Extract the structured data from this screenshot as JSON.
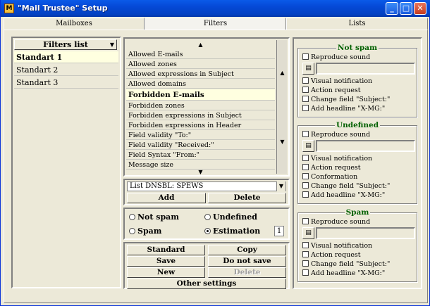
{
  "window": {
    "title": "\"Mail Trustee\" Setup",
    "app_icon": "M"
  },
  "titlebar_buttons": {
    "minimize": "_",
    "maximize": "□",
    "close": "✕"
  },
  "tabs": [
    {
      "label": "Mailboxes",
      "active": false
    },
    {
      "label": "Filters",
      "active": true
    },
    {
      "label": "Lists",
      "active": false
    }
  ],
  "filters_list": {
    "header": "Filters list",
    "dropdown_icon": "▼",
    "items": [
      "Standart 1",
      "Standart 2",
      "Standart 3"
    ],
    "selected": "Standart 1"
  },
  "rules": {
    "scroll_up": "▲",
    "scroll_down": "▼",
    "items": [
      "Allowed E-mails",
      "Allowed zones",
      "Allowed expressions in Subject",
      "Allowed domains",
      "Forbidden E-mails",
      "Forbidden zones",
      "Forbidden expressions in Subject",
      "Forbidden expressions in Header",
      "Field validity \"To:\"",
      "Field validity \"Received:\"",
      "Field Syntax \"From:\"",
      "Message size"
    ],
    "selected": "Forbidden E-mails"
  },
  "dnsbl": {
    "selected": "List DNSBL: SPEWS",
    "dropdown_icon": "▼",
    "add_label": "Add",
    "delete_label": "Delete"
  },
  "classification": {
    "not_spam": "Not spam",
    "undefined": "Undefined",
    "spam": "Spam",
    "estimation": "Estimation",
    "estimation_value": "1",
    "checked": "estimation"
  },
  "actions": {
    "standard": "Standard",
    "copy": "Copy",
    "save": "Save",
    "do_not_save": "Do not save",
    "new": "New",
    "delete": "Delete",
    "other_settings": "Other settings"
  },
  "groups": {
    "not_spam": {
      "title": "Not spam",
      "reproduce_sound": "Reproduce sound",
      "options": [
        "Visual notification",
        "Action request",
        "Change field \"Subject:\"",
        "Add headline \"X-MG:\""
      ]
    },
    "undefined": {
      "title": "Undefined",
      "reproduce_sound": "Reproduce sound",
      "options": [
        "Visual notification",
        "Action request",
        "Conformation",
        "Change field \"Subject:\"",
        "Add headline \"X-MG:\""
      ]
    },
    "spam": {
      "title": "Spam",
      "reproduce_sound": "Reproduce sound",
      "options": [
        "Visual notification",
        "Action request",
        "Change field \"Subject:\"",
        "Add headline \"X-MG:\""
      ]
    }
  },
  "file_browse_icon": "▤"
}
